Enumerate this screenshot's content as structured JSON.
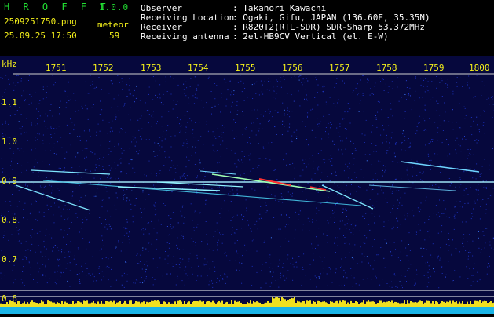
{
  "header": {
    "app_name": "H R O F F T",
    "version": "1.0.0",
    "filename": "2509251750.png",
    "datetime": "25.09.25 17:50",
    "count_label": "meteor",
    "count_value": "59",
    "info_labels": [
      "Observer",
      "Receiving Location",
      "Receiver",
      "Receiving antenna"
    ],
    "info_values": [
      ": Takanori Kawachi",
      ": Ogaki, Gifu, JAPAN (136.60E, 35.35N)",
      ": R820T2(RTL-SDR) SDR-Sharp 53.372MHz",
      ": 2el-HB9CV Vertical (el. E-W)"
    ]
  },
  "axes": {
    "y_unit": "kHz",
    "time_ticks": [
      "1751",
      "1752",
      "1753",
      "1754",
      "1755",
      "1756",
      "1757",
      "1758",
      "1759",
      "1800"
    ],
    "freq_ticks": [
      "1.1",
      "1.0",
      "0.9",
      "0.8",
      "0.7",
      "0.6"
    ]
  },
  "colors": {
    "background": "#06083d",
    "noise": "#1a2fb8",
    "carrier": "#a8f0ff",
    "echo": "#7fe7ff",
    "strong_echo": "#ff3030",
    "header_title": "#22e033",
    "header_meta": "#f4f01a",
    "axis_text": "#f4f01a",
    "info_text": "#ffffff",
    "level_bar": "#f0e020",
    "level_base": "#1ab4e6"
  }
}
